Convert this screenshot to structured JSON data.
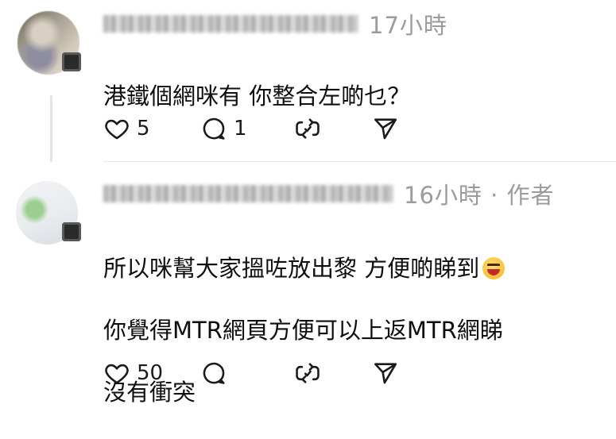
{
  "comments": [
    {
      "timestamp": "17小時",
      "text": "港鐵個網咪有 你整合左啲乜？",
      "likes": "5",
      "replies": "1"
    },
    {
      "timestamp": "16小時 · 作者",
      "text": "所以咪幫大家搵咗放出黎 方便啲睇到",
      "text_line2": "你覺得MTR網頁方便可以上返MTR網睇",
      "text_line3": "沒有￼衝突",
      "emoji": "grinning-squinting-face",
      "likes": "50"
    }
  ],
  "icons": {
    "like": "heart-icon",
    "reply": "comment-icon",
    "repost": "repost-icon",
    "share": "send-icon"
  }
}
